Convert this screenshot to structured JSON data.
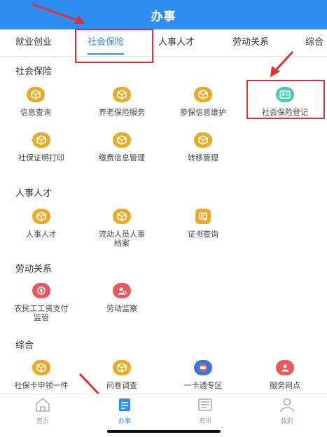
{
  "header": {
    "title": "办事",
    "color": "#2d8ef0"
  },
  "tabs": [
    {
      "label": "就业创业",
      "active": false
    },
    {
      "label": "社会保险",
      "active": true
    },
    {
      "label": "人事人才",
      "active": false
    },
    {
      "label": "劳动关系",
      "active": false
    },
    {
      "label": "综合",
      "active": false
    }
  ],
  "sections": [
    {
      "title": "社会保险",
      "items": [
        {
          "label": "信息查询",
          "icon": "cube-icon"
        },
        {
          "label": "养老保险服务",
          "icon": "cube-icon"
        },
        {
          "label": "参保信息维护",
          "icon": "cube-icon"
        },
        {
          "label": "社会保险登记",
          "icon": "id-card-icon"
        },
        {
          "label": "社保证明打印",
          "icon": "cube-icon"
        },
        {
          "label": "缴费信息管理",
          "icon": "cube-icon"
        },
        {
          "label": "转移管理",
          "icon": "cube-icon"
        }
      ]
    },
    {
      "title": "人事人才",
      "items": [
        {
          "label": "人事人才",
          "icon": "cube-icon"
        },
        {
          "label": "流动人员人事",
          "label2": "档案",
          "icon": "cube-icon"
        },
        {
          "label": "证书查询",
          "icon": "certificate-icon"
        }
      ]
    },
    {
      "title": "劳动关系",
      "items": [
        {
          "label": "农民工工资支付",
          "label2": "监管",
          "icon": "wage-icon"
        },
        {
          "label": "劳动监察",
          "icon": "inspector-icon"
        }
      ]
    },
    {
      "title": "综合",
      "items": [
        {
          "label": "社保卡申领一件",
          "icon": "cube-icon"
        },
        {
          "label": "问卷调查",
          "icon": "cube-icon"
        },
        {
          "label": "一卡通专区",
          "icon": "card-icon"
        },
        {
          "label": "服务网点",
          "icon": "location-pin-icon"
        }
      ]
    }
  ],
  "bottom_nav": [
    {
      "label": "首页",
      "icon": "home-icon",
      "active": false
    },
    {
      "label": "办事",
      "icon": "tasks-icon",
      "active": true
    },
    {
      "label": "资讯",
      "icon": "news-icon",
      "active": false
    },
    {
      "label": "我的",
      "icon": "user-icon",
      "active": false
    }
  ],
  "colors": {
    "accent": "#2d8ef0",
    "icon_gold": "#e9ab26",
    "icon_teal": "#4fc7b3",
    "icon_red": "#e9585f",
    "icon_blue": "#3a78d8",
    "highlight_red": "#e23030"
  }
}
